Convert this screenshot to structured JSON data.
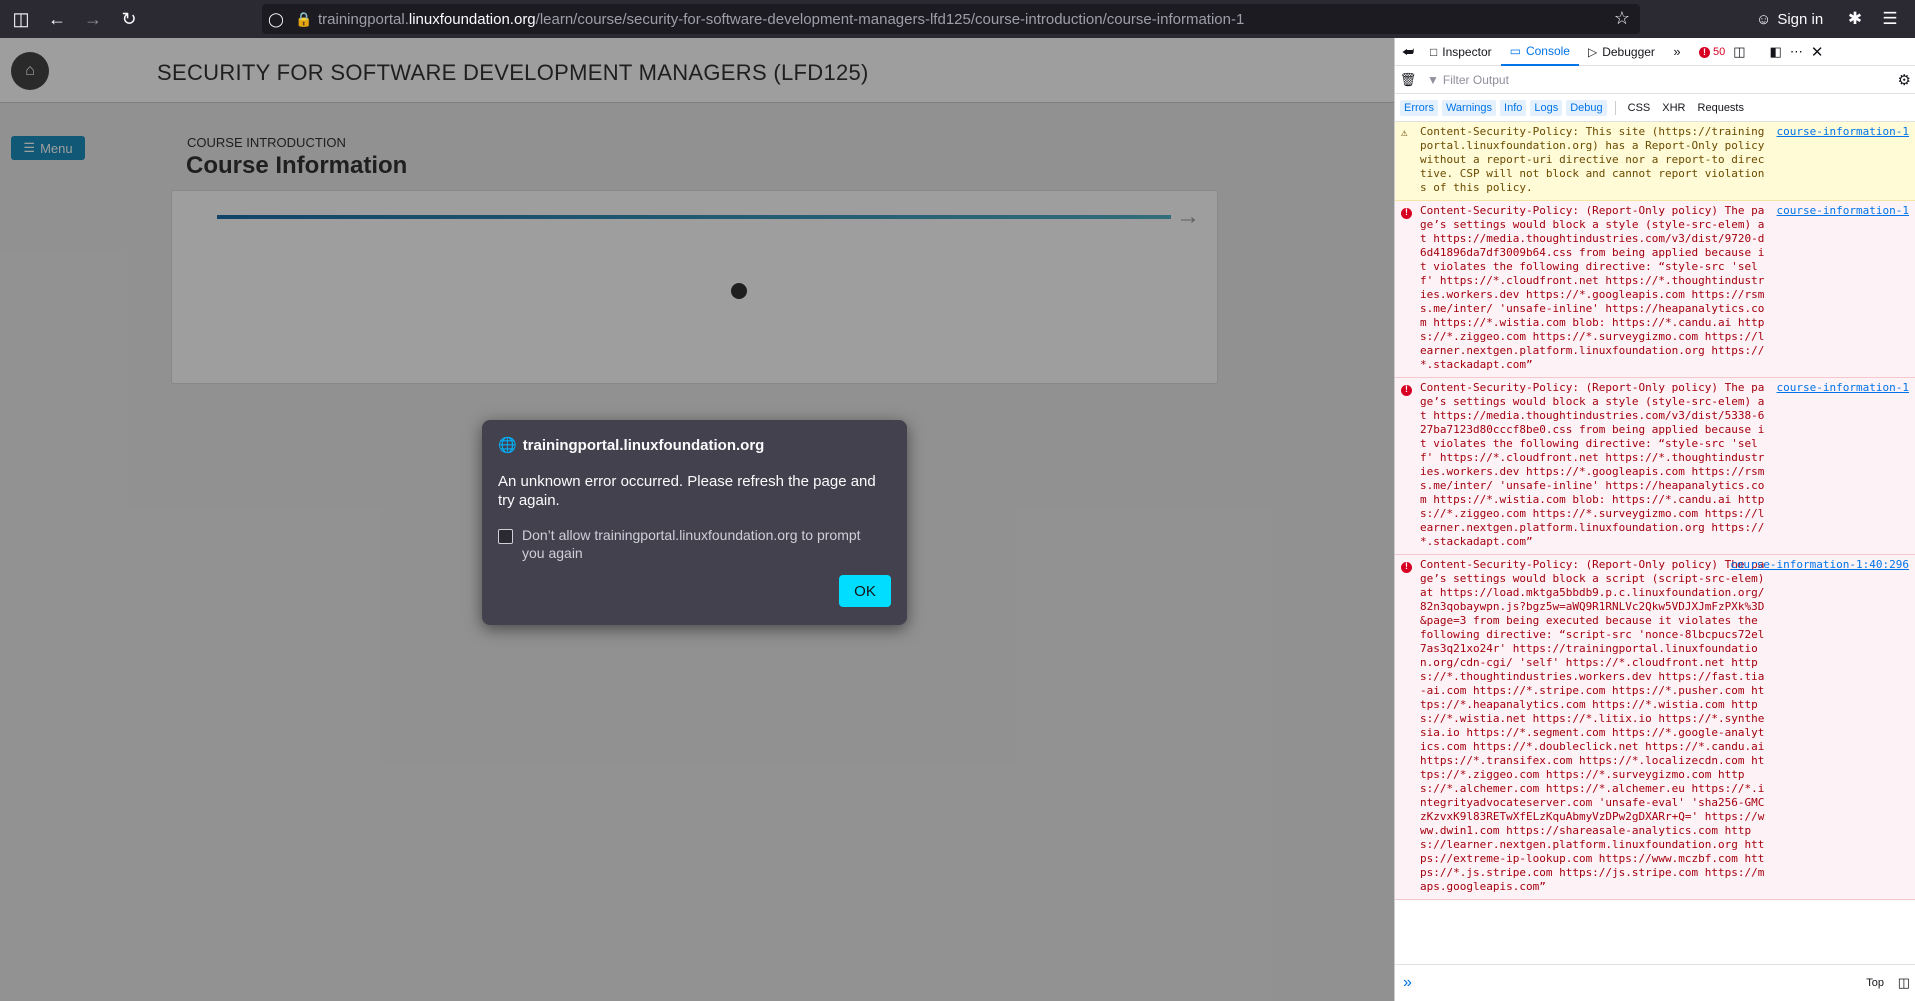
{
  "browser": {
    "url_prefix": "trainingportal.",
    "url_host": "linuxfoundation.org",
    "url_path": "/learn/course/security-for-software-development-managers-lfd125/course-introduction/course-information-1",
    "signin_label": "Sign in"
  },
  "page": {
    "course_title": "SECURITY FOR SOFTWARE DEVELOPMENT MANAGERS (LFD125)",
    "menu_label": "Menu",
    "section_label": "COURSE INTRODUCTION",
    "heading": "Course Information"
  },
  "dialog": {
    "site": "trainingportal.linuxfoundation.org",
    "message": "An unknown error occurred. Please refresh the page and try again.",
    "checkbox_label": "Don’t allow trainingportal.linuxfoundation.org to prompt you again",
    "ok_label": "OK"
  },
  "devtools": {
    "tabs": [
      "Inspector",
      "Console",
      "Debugger"
    ],
    "error_count": "50",
    "filter_placeholder": "Filter Output",
    "levels": [
      "Errors",
      "Warnings",
      "Info",
      "Logs",
      "Debug"
    ],
    "extra_filters": [
      "CSS",
      "XHR",
      "Requests"
    ],
    "context": "Top",
    "messages": [
      {
        "type": "warning",
        "source": "course-information-1",
        "text": "Content-Security-Policy: This site (https://trainingportal.linuxfoundation.org) has a Report-Only policy without a report-uri directive nor a report-to directive. CSP will not block and cannot report violations of this policy."
      },
      {
        "type": "error",
        "source": "course-information-1",
        "text": "Content-Security-Policy: (Report-Only policy) The page’s settings would block a style (style-src-elem) at https://media.thoughtindustries.com/v3/dist/9720-d6d41896da7df3009b64.css from being applied because it violates the following directive: “style-src 'self' https://*.cloudfront.net https://*.thoughtindustries.workers.dev https://*.googleapis.com https://rsms.me/inter/ 'unsafe-inline' https://heapanalytics.com https://*.wistia.com blob: https://*.candu.ai https://*.ziggeo.com https://*.surveygizmo.com https://learner.nextgen.platform.linuxfoundation.org https://*.stackadapt.com”"
      },
      {
        "type": "error",
        "source": "course-information-1",
        "text": "Content-Security-Policy: (Report-Only policy) The page’s settings would block a style (style-src-elem) at https://media.thoughtindustries.com/v3/dist/5338-627ba7123d80cccf8be0.css from being applied because it violates the following directive: “style-src 'self' https://*.cloudfront.net https://*.thoughtindustries.workers.dev https://*.googleapis.com https://rsms.me/inter/ 'unsafe-inline' https://heapanalytics.com https://*.wistia.com blob: https://*.candu.ai https://*.ziggeo.com https://*.surveygizmo.com https://learner.nextgen.platform.linuxfoundation.org https://*.stackadapt.com”"
      },
      {
        "type": "error",
        "source": "course-information-1:40:296",
        "text": "Content-Security-Policy: (Report-Only policy) The page’s settings would block a script (script-src-elem) at https://load.mktga5bbdb9.p.c.linuxfoundation.org/82n3qobaywpn.js?bgz5w=aWQ9R1RNLVc2Qkw5VDJXJmFzPXk%3D&page=3 from being executed because it violates the following directive: “script-src 'nonce-8lbcpucs72el7as3q21xo24r' https://trainingportal.linuxfoundation.org/cdn-cgi/ 'self' https://*.cloudfront.net https://*.thoughtindustries.workers.dev https://fast.tia-ai.com https://*.stripe.com https://*.pusher.com https://*.heapanalytics.com https://*.wistia.com https://*.wistia.net https://*.litix.io https://*.synthesia.io https://*.segment.com https://*.google-analytics.com https://*.doubleclick.net https://*.candu.ai https://*.transifex.com https://*.localizecdn.com https://*.ziggeo.com https://*.surveygizmo.com https://*.alchemer.com https://*.alchemer.eu https://*.integrityadvocateserver.com 'unsafe-eval' 'sha256-GMCzKzvxK9l83RETwXfELzKquAbmyVzDPw2gDXARr+Q=' https://www.dwin1.com https://shareasale-analytics.com https://learner.nextgen.platform.linuxfoundation.org https://extreme-ip-lookup.com https://www.mczbf.com https://*.js.stripe.com https://js.stripe.com https://maps.googleapis.com”"
      }
    ]
  }
}
